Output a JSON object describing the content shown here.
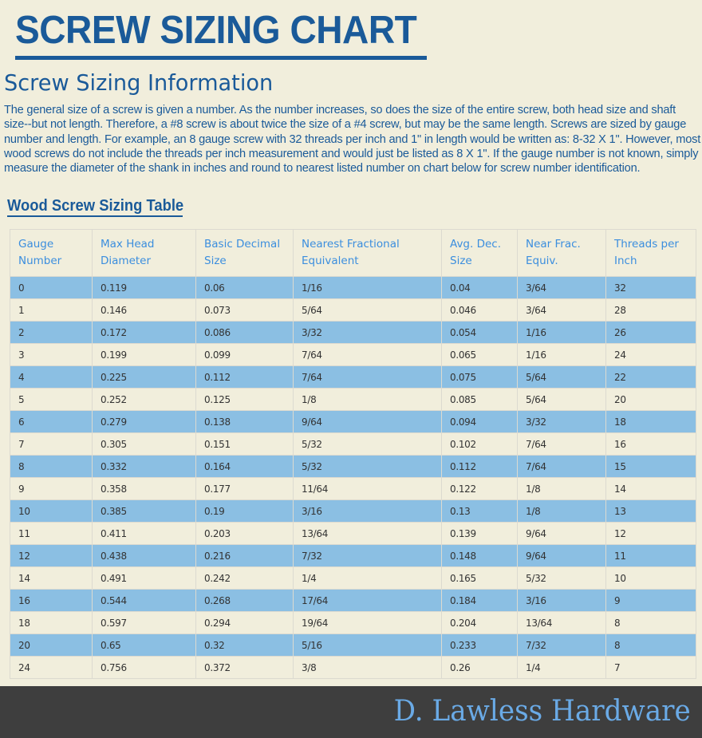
{
  "header": {
    "title": "SCREW SIZING CHART",
    "subtitle": "Screw Sizing Information"
  },
  "intro": {
    "text": "The general size of a screw is given a number. As the number increases, so does the size of the entire screw, both head size and shaft size--but not length. Therefore, a #8 screw is about twice the size of a #4 screw, but may be the same length. Screws are sized by gauge number and length. For example, an 8 gauge screw with 32 threads per inch and 1\" in length would be written as: 8-32 X 1\". However, most wood screws do not include the threads per inch measurement and would just be listed as 8 X 1\". If the gauge number is not known, simply measure the diameter of the shank in inches and round to nearest listed number on chart below for screw number identification."
  },
  "table": {
    "title": "Wood Screw Sizing Table",
    "columns": [
      "Gauge Number",
      "Max Head Diameter",
      "Basic Decimal Size",
      "Nearest Fractional Equivalent",
      "Avg. Dec. Size",
      "Near Frac. Equiv.",
      "Threads per Inch"
    ],
    "rows": [
      [
        "0",
        "0.119",
        "0.06",
        "1/16",
        "0.04",
        "3/64",
        "32"
      ],
      [
        "1",
        "0.146",
        "0.073",
        "5/64",
        "0.046",
        "3/64",
        "28"
      ],
      [
        "2",
        "0.172",
        "0.086",
        "3/32",
        "0.054",
        "1/16",
        "26"
      ],
      [
        "3",
        "0.199",
        "0.099",
        "7/64",
        "0.065",
        "1/16",
        "24"
      ],
      [
        "4",
        "0.225",
        "0.112",
        "7/64",
        "0.075",
        "5/64",
        "22"
      ],
      [
        "5",
        "0.252",
        "0.125",
        "1/8",
        "0.085",
        "5/64",
        "20"
      ],
      [
        "6",
        "0.279",
        "0.138",
        "9/64",
        "0.094",
        "3/32",
        "18"
      ],
      [
        "7",
        "0.305",
        "0.151",
        "5/32",
        "0.102",
        "7/64",
        "16"
      ],
      [
        "8",
        "0.332",
        "0.164",
        "5/32",
        "0.112",
        "7/64",
        "15"
      ],
      [
        "9",
        "0.358",
        "0.177",
        "11/64",
        "0.122",
        "1/8",
        "14"
      ],
      [
        "10",
        "0.385",
        "0.19",
        "3/16",
        "0.13",
        "1/8",
        "13"
      ],
      [
        "11",
        "0.411",
        "0.203",
        "13/64",
        "0.139",
        "9/64",
        "12"
      ],
      [
        "12",
        "0.438",
        "0.216",
        "7/32",
        "0.148",
        "9/64",
        "11"
      ],
      [
        "14",
        "0.491",
        "0.242",
        "1/4",
        "0.165",
        "5/32",
        "10"
      ],
      [
        "16",
        "0.544",
        "0.268",
        "17/64",
        "0.184",
        "3/16",
        "9"
      ],
      [
        "18",
        "0.597",
        "0.294",
        "19/64",
        "0.204",
        "13/64",
        "8"
      ],
      [
        "20",
        "0.65",
        "0.32",
        "5/16",
        "0.233",
        "7/32",
        "8"
      ],
      [
        "24",
        "0.756",
        "0.372",
        "3/8",
        "0.26",
        "1/4",
        "7"
      ]
    ]
  },
  "footer": {
    "brand": "D. Lawless Hardware"
  },
  "colors": {
    "page_background": "#f1eedc",
    "heading_blue": "#1a5a99",
    "column_header_blue": "#3b8ede",
    "striped_row_blue": "#8bbfe3",
    "footer_background": "#3e3e3e",
    "footer_text": "#6aaae6"
  }
}
